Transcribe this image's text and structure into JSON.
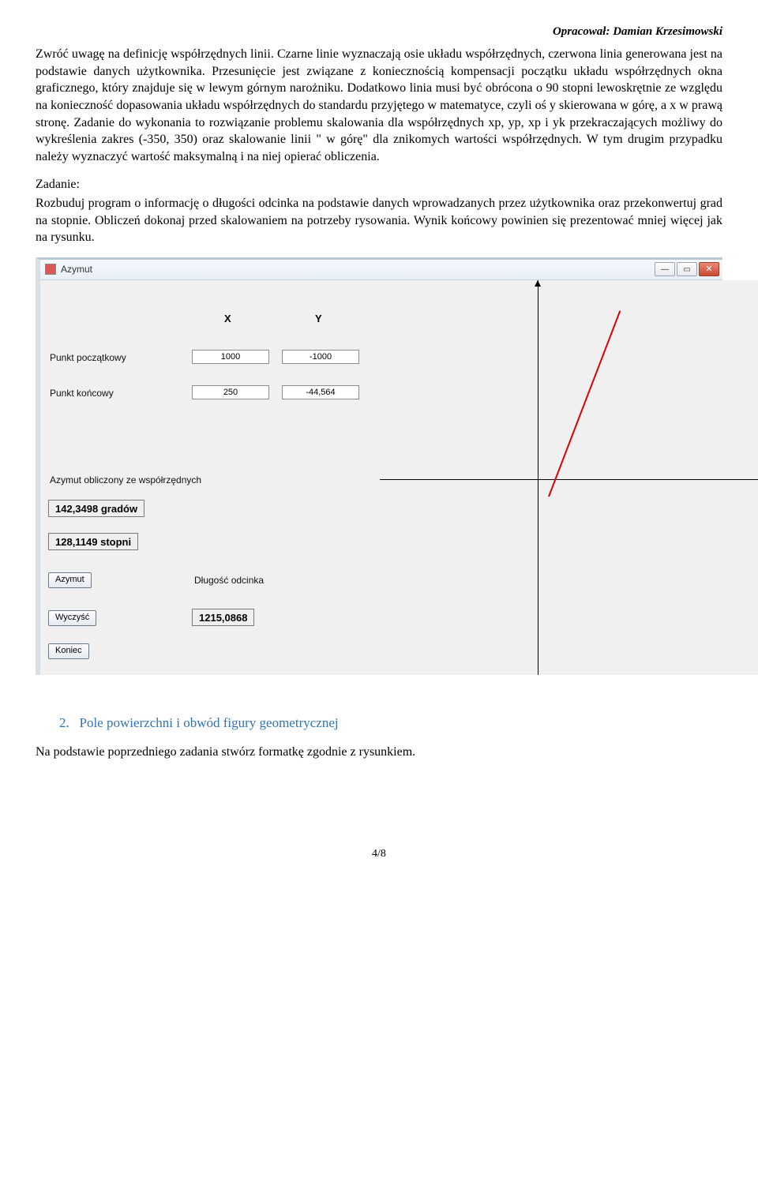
{
  "author_line": "Opracował: Damian Krzesimowski",
  "para1": "Zwróć uwagę na definicję współrzędnych linii. Czarne linie wyznaczają osie układu współrzędnych, czerwona linia generowana jest na podstawie danych użytkownika. Przesunięcie jest związane z koniecznością kompensacji początku układu współrzędnych okna graficznego, który znajduje się w lewym górnym narożniku. Dodatkowo linia musi być obrócona o 90 stopni lewoskrętnie ze względu na konieczność dopasowania układu współrzędnych do standardu przyjętego w matematyce, czyli oś y skierowana w górę, a x w prawą stronę. Zadanie do wykonania to rozwiązanie problemu skalowania dla współrzędnych xp, yp, xp i yk przekraczających możliwy do wykreślenia zakres (-350, 350) oraz skalowanie linii \" w górę\" dla znikomych wartości współrzędnych. W tym drugim przypadku należy wyznaczyć wartość maksymalną i na niej opierać obliczenia.",
  "task_label": "Zadanie:",
  "task_text": "Rozbuduj program o informację o długości odcinka na podstawie danych wprowadzanych przez użytkownika oraz przekonwertuj grad na stopnie. Obliczeń dokonaj przed skalowaniem na potrzeby rysowania. Wynik końcowy powinien się prezentować mniej więcej jak na rysunku.",
  "window": {
    "title": "Azymut",
    "col_x": "X",
    "col_y": "Y",
    "row1": "Punkt początkowy",
    "row2": "Punkt końcowy",
    "val_x1": "1000",
    "val_y1": "-1000",
    "val_x2": "250",
    "val_y2": "-44,564",
    "azimuth_label": "Azymut obliczony ze współrzędnych",
    "readout_grad": "142,3498 gradów",
    "readout_deg": "128,1149 stopni",
    "btn_azymut": "Azymut",
    "btn_clear": "Wyczyść",
    "btn_exit": "Koniec",
    "length_label": "Długość odcinka",
    "length_value": "1215,0868"
  },
  "section": {
    "num": "2.",
    "title": "Pole powierzchni i obwód figury geometrycznej",
    "text_after": "Na podstawie poprzedniego zadania stwórz formatkę zgodnie z rysunkiem."
  },
  "page_footer": "4/8"
}
